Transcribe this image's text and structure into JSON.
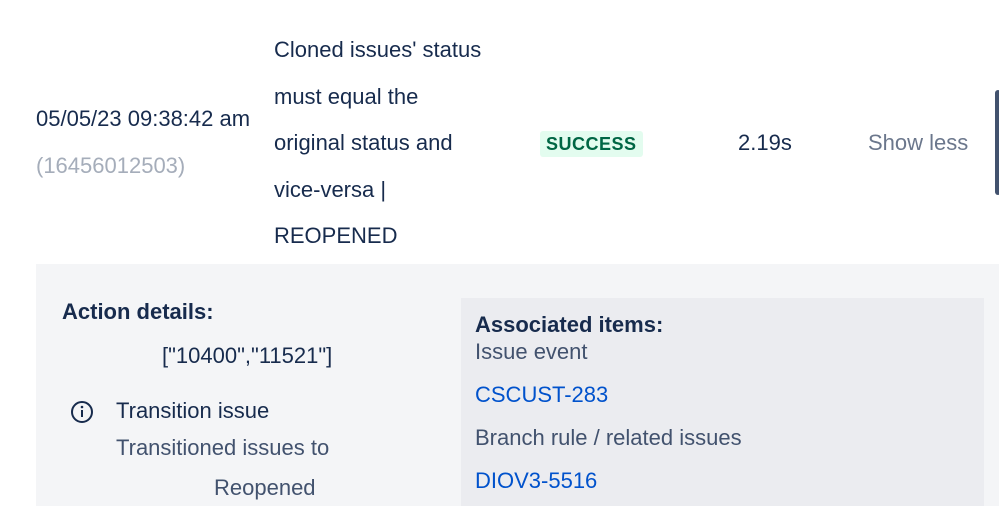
{
  "execution": {
    "date": "05/05/23 09:38:42 am",
    "audit_id": "(16456012503)",
    "rule_lines": [
      "Cloned issues' status",
      "must equal the",
      "original status and",
      "vice-versa |",
      "REOPENED"
    ],
    "status": "SUCCESS",
    "duration": "2.19s",
    "toggle_label": "Show less"
  },
  "action_details": {
    "title": "Action details:",
    "values": "[\"10400\",\"11521\"]",
    "icon": "info-icon",
    "action_name": "Transition issue",
    "description": "Transitioned issues to",
    "target": "Reopened"
  },
  "associated": {
    "title": "Associated items:",
    "groups": [
      {
        "label": "Issue event",
        "link": "CSCUST-283"
      },
      {
        "label": "Branch rule / related issues",
        "link": "DIOV3-5516"
      }
    ]
  },
  "colors": {
    "success_bg": "#e3fcef",
    "success_text": "#006644",
    "link": "#0052cc"
  }
}
